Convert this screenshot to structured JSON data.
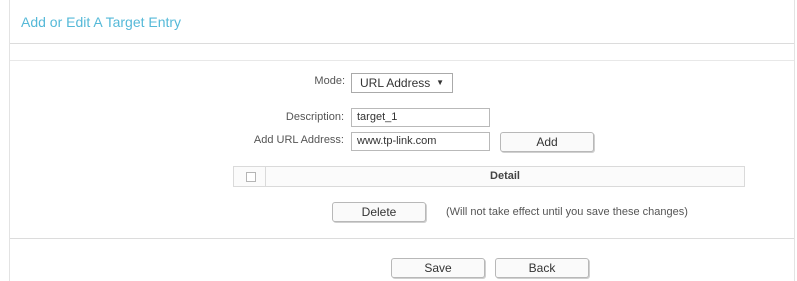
{
  "header": {
    "title": "Add or Edit A Target Entry"
  },
  "form": {
    "mode_label": "Mode:",
    "mode_value": "URL Address",
    "mode_caret": "▼",
    "description_label": "Description:",
    "description_value": "target_1",
    "url_label": "Add URL Address:",
    "url_value": "www.tp-link.com",
    "add_button": "Add"
  },
  "table": {
    "columns": [
      "",
      "Detail"
    ]
  },
  "actions": {
    "delete_button": "Delete",
    "delete_note": "(Will not take effect until you save these changes)",
    "save_button": "Save",
    "back_button": "Back"
  },
  "colors": {
    "title": "#55b9d8",
    "border": "#dcdcdc"
  }
}
